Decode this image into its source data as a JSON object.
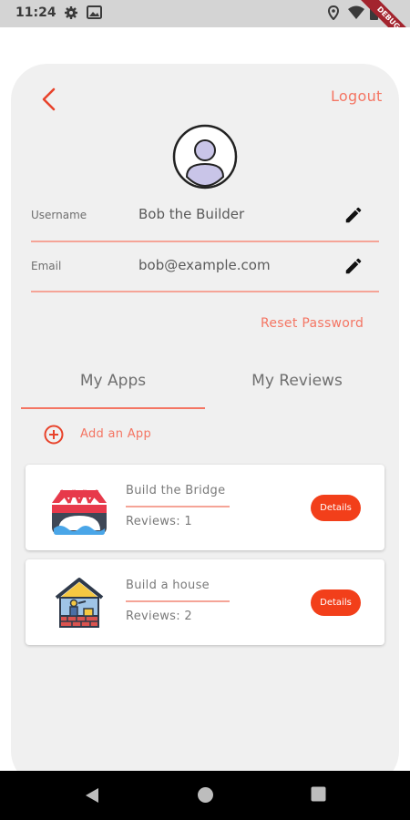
{
  "status_bar": {
    "time": "11:24",
    "icons": [
      "gear-icon",
      "image-icon",
      "location-icon",
      "wifi-icon",
      "battery-icon"
    ],
    "debug_banner": "DEBUG"
  },
  "header": {
    "back_icon": "chevron-left-icon",
    "logout_label": "Logout"
  },
  "profile": {
    "avatar_icon": "user-avatar-icon",
    "username_label": "Username",
    "username_value": "Bob the Builder",
    "email_label": "Email",
    "email_value": "bob@example.com",
    "edit_icon": "pencil-icon",
    "reset_password_label": "Reset Password"
  },
  "tabs": [
    {
      "label": "My Apps",
      "selected": true
    },
    {
      "label": "My Reviews",
      "selected": false
    }
  ],
  "add_app_label": "Add an App",
  "apps": [
    {
      "name": "Build the Bridge",
      "reviews": "Reviews: 1",
      "icon": "bridge-icon",
      "details_label": "Details"
    },
    {
      "name": "Build a house",
      "reviews": "Reviews: 2",
      "icon": "house-construction-icon",
      "details_label": "Details"
    }
  ],
  "colors": {
    "accent": "#f47563",
    "details_button": "#f23f1a",
    "card_background": "#f0f0f0"
  },
  "nav_bar": {
    "icons": [
      "back-triangle-icon",
      "home-circle-icon",
      "recents-square-icon"
    ]
  }
}
